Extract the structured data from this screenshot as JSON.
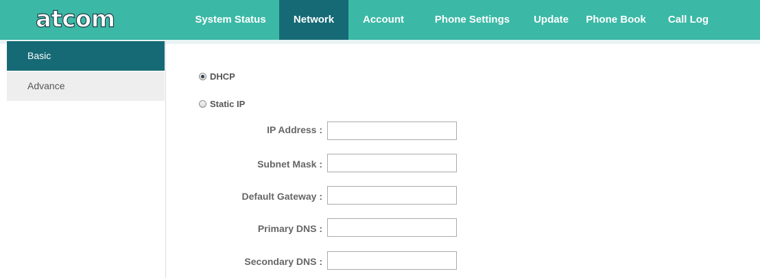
{
  "app": {
    "logo_text": "atcom"
  },
  "nav": {
    "items": [
      {
        "label": "System Status",
        "active": false
      },
      {
        "label": "Network",
        "active": true
      },
      {
        "label": "Account",
        "active": false
      },
      {
        "label": "Phone Settings",
        "active": false
      },
      {
        "label": "Update",
        "active": false
      },
      {
        "label": "Phone Book",
        "active": false
      },
      {
        "label": "Call Log",
        "active": false
      }
    ]
  },
  "sidebar": {
    "items": [
      {
        "label": "Basic",
        "active": true
      },
      {
        "label": "Advance",
        "active": false
      }
    ]
  },
  "form": {
    "mode_options": [
      {
        "label": "DHCP",
        "checked": true
      },
      {
        "label": "Static IP",
        "checked": false
      }
    ],
    "fields": [
      {
        "label": "IP Address :",
        "value": ""
      },
      {
        "label": "Subnet Mask :",
        "value": ""
      },
      {
        "label": "Default Gateway :",
        "value": ""
      },
      {
        "label": "Primary DNS :",
        "value": ""
      },
      {
        "label": "Secondary DNS :",
        "value": ""
      }
    ]
  },
  "colors": {
    "header_bg": "#3bb9a6",
    "active_bg": "#166a76",
    "sidebar_item_bg": "#eeeeee",
    "label_color": "#666666"
  }
}
